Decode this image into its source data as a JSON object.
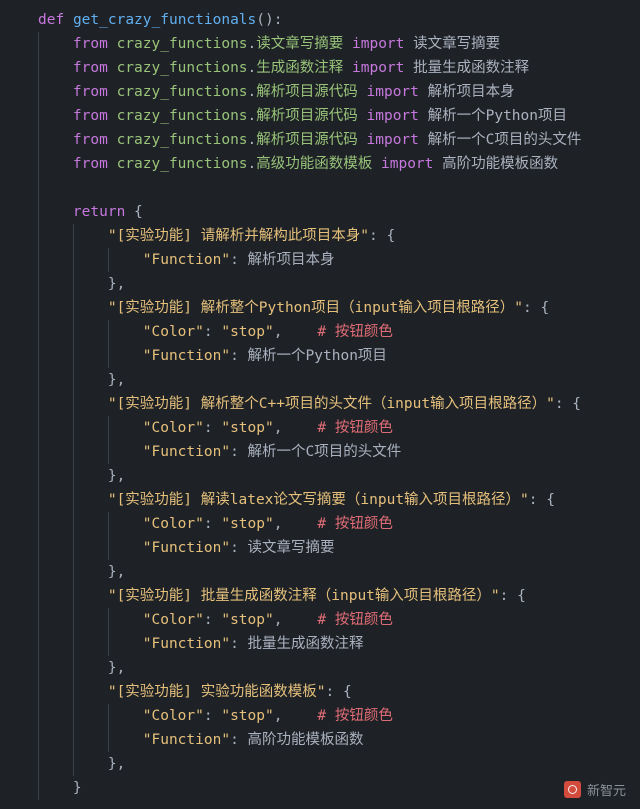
{
  "editor": {
    "background": "#1e2227",
    "language": "python",
    "colors": {
      "keyword": "#c678dd",
      "function": "#61afef",
      "module": "#98c379",
      "string": "#e5c07b",
      "comment": "#e06c75",
      "plain": "#abb2bf",
      "brace": "#d19a66",
      "indent_guide": "#3a4048"
    }
  },
  "code": {
    "lines": [
      {
        "indent": 0,
        "tokens": [
          {
            "c": "kw",
            "t": "def"
          },
          {
            "c": "plain",
            "t": " "
          },
          {
            "c": "fn",
            "t": "get_crazy_functionals"
          },
          {
            "c": "punct",
            "t": "():"
          }
        ]
      },
      {
        "indent": 1,
        "tokens": [
          {
            "c": "kw",
            "t": "from"
          },
          {
            "c": "plain",
            "t": " "
          },
          {
            "c": "mod",
            "t": "crazy_functions"
          },
          {
            "c": "punct",
            "t": "."
          },
          {
            "c": "mod",
            "t": "读文章写摘要"
          },
          {
            "c": "plain",
            "t": " "
          },
          {
            "c": "kw",
            "t": "import"
          },
          {
            "c": "plain",
            "t": " 读文章写摘要"
          }
        ]
      },
      {
        "indent": 1,
        "tokens": [
          {
            "c": "kw",
            "t": "from"
          },
          {
            "c": "plain",
            "t": " "
          },
          {
            "c": "mod",
            "t": "crazy_functions"
          },
          {
            "c": "punct",
            "t": "."
          },
          {
            "c": "mod",
            "t": "生成函数注释"
          },
          {
            "c": "plain",
            "t": " "
          },
          {
            "c": "kw",
            "t": "import"
          },
          {
            "c": "plain",
            "t": " 批量生成函数注释"
          }
        ]
      },
      {
        "indent": 1,
        "tokens": [
          {
            "c": "kw",
            "t": "from"
          },
          {
            "c": "plain",
            "t": " "
          },
          {
            "c": "mod",
            "t": "crazy_functions"
          },
          {
            "c": "punct",
            "t": "."
          },
          {
            "c": "mod",
            "t": "解析项目源代码"
          },
          {
            "c": "plain",
            "t": " "
          },
          {
            "c": "kw",
            "t": "import"
          },
          {
            "c": "plain",
            "t": " 解析项目本身"
          }
        ]
      },
      {
        "indent": 1,
        "tokens": [
          {
            "c": "kw",
            "t": "from"
          },
          {
            "c": "plain",
            "t": " "
          },
          {
            "c": "mod",
            "t": "crazy_functions"
          },
          {
            "c": "punct",
            "t": "."
          },
          {
            "c": "mod",
            "t": "解析项目源代码"
          },
          {
            "c": "plain",
            "t": " "
          },
          {
            "c": "kw",
            "t": "import"
          },
          {
            "c": "plain",
            "t": " 解析一个Python项目"
          }
        ]
      },
      {
        "indent": 1,
        "tokens": [
          {
            "c": "kw",
            "t": "from"
          },
          {
            "c": "plain",
            "t": " "
          },
          {
            "c": "mod",
            "t": "crazy_functions"
          },
          {
            "c": "punct",
            "t": "."
          },
          {
            "c": "mod",
            "t": "解析项目源代码"
          },
          {
            "c": "plain",
            "t": " "
          },
          {
            "c": "kw",
            "t": "import"
          },
          {
            "c": "plain",
            "t": " 解析一个C项目的头文件"
          }
        ]
      },
      {
        "indent": 1,
        "tokens": [
          {
            "c": "kw",
            "t": "from"
          },
          {
            "c": "plain",
            "t": " "
          },
          {
            "c": "mod",
            "t": "crazy_functions"
          },
          {
            "c": "punct",
            "t": "."
          },
          {
            "c": "mod",
            "t": "高级功能函数模板"
          },
          {
            "c": "plain",
            "t": " "
          },
          {
            "c": "kw",
            "t": "import"
          },
          {
            "c": "plain",
            "t": " 高阶功能模板函数"
          }
        ]
      },
      {
        "indent": 0,
        "tokens": []
      },
      {
        "indent": 1,
        "tokens": [
          {
            "c": "kw",
            "t": "return"
          },
          {
            "c": "plain",
            "t": " "
          },
          {
            "c": "punct",
            "t": "{"
          }
        ]
      },
      {
        "indent": 2,
        "tokens": [
          {
            "c": "str",
            "t": "\"[实验功能] 请解析并解构此项目本身\""
          },
          {
            "c": "punct",
            "t": ": {"
          }
        ]
      },
      {
        "indent": 3,
        "tokens": [
          {
            "c": "str",
            "t": "\"Function\""
          },
          {
            "c": "punct",
            "t": ": "
          },
          {
            "c": "plain",
            "t": "解析项目本身"
          }
        ]
      },
      {
        "indent": 2,
        "tokens": [
          {
            "c": "punct",
            "t": "},"
          }
        ]
      },
      {
        "indent": 2,
        "tokens": [
          {
            "c": "str",
            "t": "\"[实验功能] 解析整个Python项目（input输入项目根路径）\""
          },
          {
            "c": "punct",
            "t": ": {"
          }
        ]
      },
      {
        "indent": 3,
        "tokens": [
          {
            "c": "str",
            "t": "\"Color\""
          },
          {
            "c": "punct",
            "t": ": "
          },
          {
            "c": "str",
            "t": "\"stop\""
          },
          {
            "c": "punct",
            "t": ","
          },
          {
            "c": "plain",
            "t": "    "
          },
          {
            "c": "comment",
            "t": "# 按钮颜色"
          }
        ]
      },
      {
        "indent": 3,
        "tokens": [
          {
            "c": "str",
            "t": "\"Function\""
          },
          {
            "c": "punct",
            "t": ": "
          },
          {
            "c": "plain",
            "t": "解析一个Python项目"
          }
        ]
      },
      {
        "indent": 2,
        "tokens": [
          {
            "c": "punct",
            "t": "},"
          }
        ]
      },
      {
        "indent": 2,
        "tokens": [
          {
            "c": "str",
            "t": "\"[实验功能] 解析整个C++项目的头文件（input输入项目根路径）\""
          },
          {
            "c": "punct",
            "t": ": {"
          }
        ]
      },
      {
        "indent": 3,
        "tokens": [
          {
            "c": "str",
            "t": "\"Color\""
          },
          {
            "c": "punct",
            "t": ": "
          },
          {
            "c": "str",
            "t": "\"stop\""
          },
          {
            "c": "punct",
            "t": ","
          },
          {
            "c": "plain",
            "t": "    "
          },
          {
            "c": "comment",
            "t": "# 按钮颜色"
          }
        ]
      },
      {
        "indent": 3,
        "tokens": [
          {
            "c": "str",
            "t": "\"Function\""
          },
          {
            "c": "punct",
            "t": ": "
          },
          {
            "c": "plain",
            "t": "解析一个C项目的头文件"
          }
        ]
      },
      {
        "indent": 2,
        "tokens": [
          {
            "c": "punct",
            "t": "},"
          }
        ]
      },
      {
        "indent": 2,
        "tokens": [
          {
            "c": "str",
            "t": "\"[实验功能] 解读latex论文写摘要（input输入项目根路径）\""
          },
          {
            "c": "punct",
            "t": ": {"
          }
        ]
      },
      {
        "indent": 3,
        "tokens": [
          {
            "c": "str",
            "t": "\"Color\""
          },
          {
            "c": "punct",
            "t": ": "
          },
          {
            "c": "str",
            "t": "\"stop\""
          },
          {
            "c": "punct",
            "t": ","
          },
          {
            "c": "plain",
            "t": "    "
          },
          {
            "c": "comment",
            "t": "# 按钮颜色"
          }
        ]
      },
      {
        "indent": 3,
        "tokens": [
          {
            "c": "str",
            "t": "\"Function\""
          },
          {
            "c": "punct",
            "t": ": "
          },
          {
            "c": "plain",
            "t": "读文章写摘要"
          }
        ]
      },
      {
        "indent": 2,
        "tokens": [
          {
            "c": "punct",
            "t": "},"
          }
        ]
      },
      {
        "indent": 2,
        "tokens": [
          {
            "c": "str",
            "t": "\"[实验功能] 批量生成函数注释（input输入项目根路径）\""
          },
          {
            "c": "punct",
            "t": ": {"
          }
        ]
      },
      {
        "indent": 3,
        "tokens": [
          {
            "c": "str",
            "t": "\"Color\""
          },
          {
            "c": "punct",
            "t": ": "
          },
          {
            "c": "str",
            "t": "\"stop\""
          },
          {
            "c": "punct",
            "t": ","
          },
          {
            "c": "plain",
            "t": "    "
          },
          {
            "c": "comment",
            "t": "# 按钮颜色"
          }
        ]
      },
      {
        "indent": 3,
        "tokens": [
          {
            "c": "str",
            "t": "\"Function\""
          },
          {
            "c": "punct",
            "t": ": "
          },
          {
            "c": "plain",
            "t": "批量生成函数注释"
          }
        ]
      },
      {
        "indent": 2,
        "tokens": [
          {
            "c": "punct",
            "t": "},"
          }
        ]
      },
      {
        "indent": 2,
        "tokens": [
          {
            "c": "str",
            "t": "\"[实验功能] 实验功能函数模板\""
          },
          {
            "c": "punct",
            "t": ": {"
          }
        ]
      },
      {
        "indent": 3,
        "tokens": [
          {
            "c": "str",
            "t": "\"Color\""
          },
          {
            "c": "punct",
            "t": ": "
          },
          {
            "c": "str",
            "t": "\"stop\""
          },
          {
            "c": "punct",
            "t": ","
          },
          {
            "c": "plain",
            "t": "    "
          },
          {
            "c": "comment",
            "t": "# 按钮颜色"
          }
        ]
      },
      {
        "indent": 3,
        "tokens": [
          {
            "c": "str",
            "t": "\"Function\""
          },
          {
            "c": "punct",
            "t": ": "
          },
          {
            "c": "plain",
            "t": "高阶功能模板函数"
          }
        ]
      },
      {
        "indent": 2,
        "tokens": [
          {
            "c": "punct",
            "t": "},"
          }
        ]
      },
      {
        "indent": 1,
        "tokens": [
          {
            "c": "punct",
            "t": "}"
          }
        ]
      }
    ]
  },
  "watermark": {
    "label": "新智元",
    "logo_icon": "circle-logo-icon"
  }
}
